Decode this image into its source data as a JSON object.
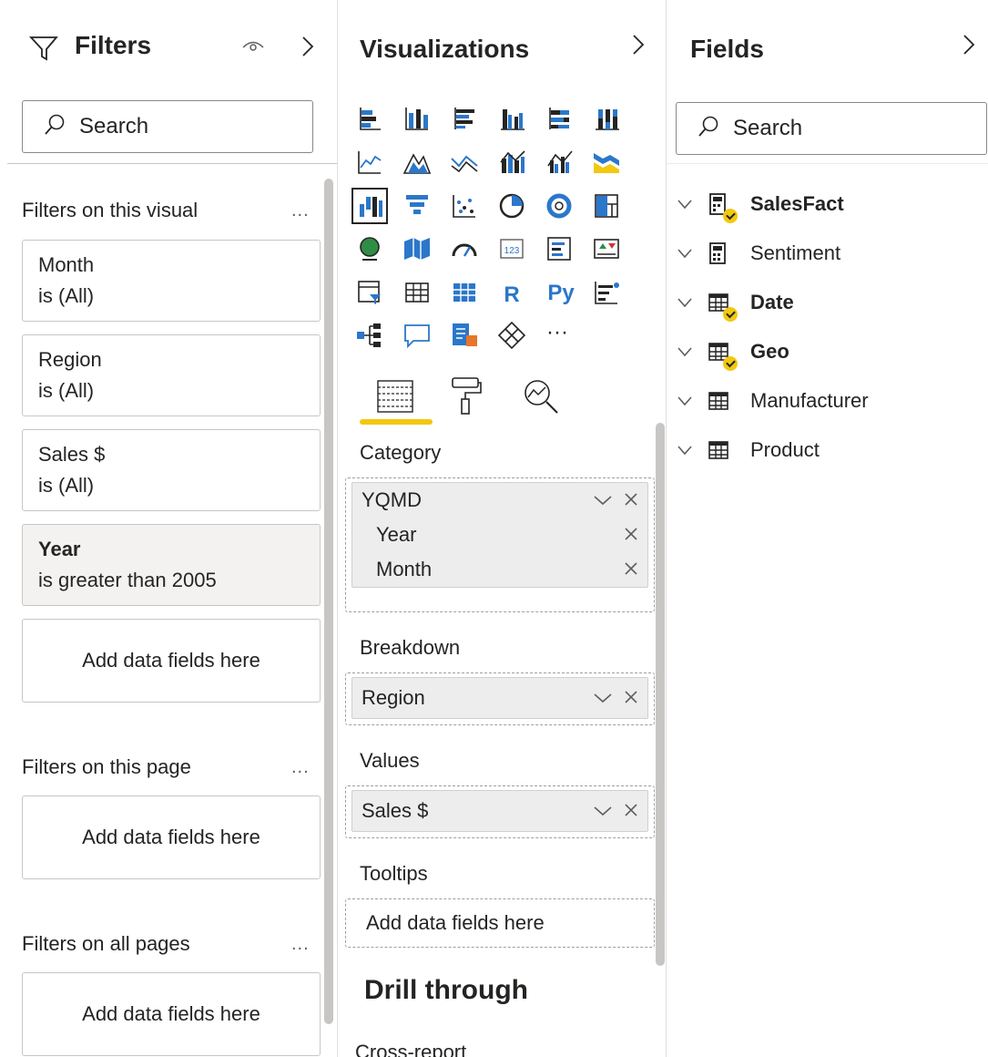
{
  "filters": {
    "title": "Filters",
    "search_label": "Search",
    "visual_section": "Filters on this visual",
    "visual_cards": [
      {
        "field": "Month",
        "condition": "is (All)"
      },
      {
        "field": "Region",
        "condition": "is (All)"
      },
      {
        "field": "Sales $",
        "condition": "is (All)"
      },
      {
        "field": "Year",
        "condition": "is greater than 2005"
      }
    ],
    "add_label_1": "Add data fields here",
    "page_section": "Filters on this page",
    "add_label_2": "Add data fields here",
    "all_section": "Filters on all pages",
    "add_label_3": "Add data fields here",
    "more": "..."
  },
  "visualizations": {
    "title": "Visualizations",
    "more_visuals": "···",
    "r_label": "R",
    "py_label": "Py",
    "category_label": "Category",
    "category_field": "YQMD",
    "category_sub": [
      "Year",
      "Month"
    ],
    "breakdown_label": "Breakdown",
    "breakdown_field": "Region",
    "values_label": "Values",
    "values_field": "Sales $",
    "tooltips_label": "Tooltips",
    "tooltips_add": "Add data fields here",
    "drill_through": "Drill through",
    "cross_report": "Cross-report"
  },
  "fields": {
    "title": "Fields",
    "search_label": "Search",
    "tables": [
      {
        "name": "SalesFact",
        "checked": true
      },
      {
        "name": "Sentiment",
        "checked": false
      },
      {
        "name": "Date",
        "checked": true
      },
      {
        "name": "Geo",
        "checked": true
      },
      {
        "name": "Manufacturer",
        "checked": false
      },
      {
        "name": "Product",
        "checked": false
      }
    ]
  },
  "colors": {
    "accent": "#f2c811",
    "blue": "#2b77c9",
    "text": "#252423"
  }
}
